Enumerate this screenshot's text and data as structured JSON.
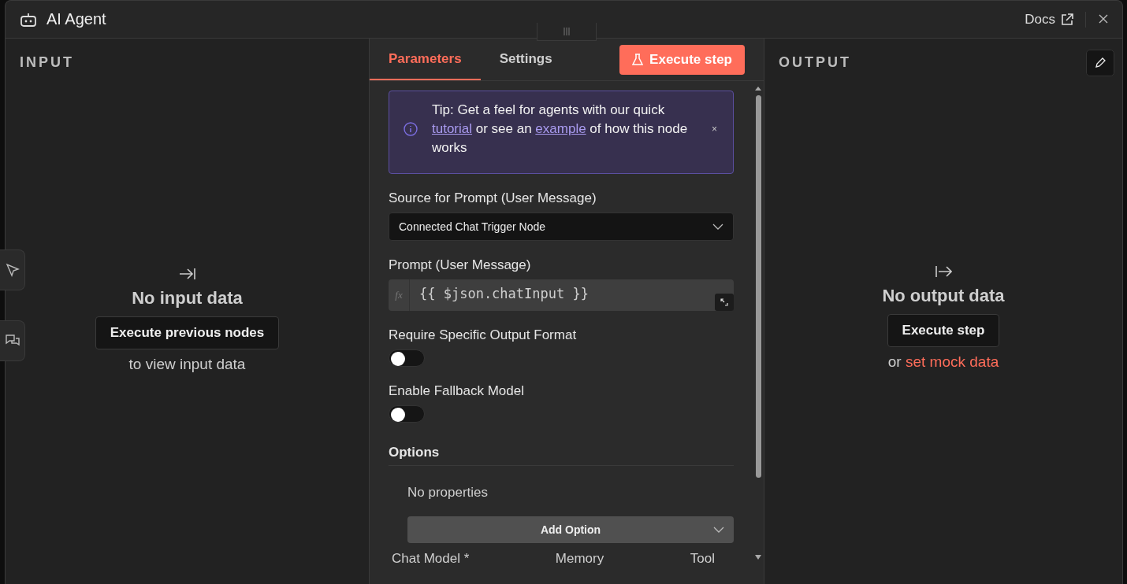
{
  "window": {
    "title": "AI Agent",
    "docs_link": "Docs"
  },
  "input_panel": {
    "heading": "INPUT",
    "empty_title": "No input data",
    "button": "Execute previous nodes",
    "hint": "to view input data"
  },
  "parameters_panel": {
    "tabs": [
      {
        "label": "Parameters",
        "selected": true
      },
      {
        "label": "Settings",
        "selected": false
      }
    ],
    "execute_button": "Execute step",
    "tip": [
      {
        "kind": "text",
        "text": "Tip: Get a feel for agents with our quick "
      },
      {
        "kind": "link",
        "text": "tutorial"
      },
      {
        "kind": "text",
        "text": " or see an "
      },
      {
        "kind": "link",
        "text": "example"
      },
      {
        "kind": "text",
        "text": " of how this node works"
      }
    ],
    "tip_close": "×",
    "fields": [
      {
        "kind": "select",
        "label": "Source for Prompt (User Message)",
        "value": "Connected Chat Trigger Node"
      },
      {
        "kind": "expression",
        "label": "Prompt (User Message)",
        "prefix": "fx",
        "value": "{{ $json.chatInput }}"
      },
      {
        "kind": "toggle",
        "label": "Require Specific Output Format",
        "on": false
      },
      {
        "kind": "toggle",
        "label": "Enable Fallback Model",
        "on": false
      }
    ],
    "options": {
      "heading": "Options",
      "empty": "No properties",
      "add_button": "Add Option"
    },
    "connections": [
      "Chat Model *",
      "Memory",
      "Tool"
    ]
  },
  "output_panel": {
    "heading": "OUTPUT",
    "empty_title": "No output data",
    "button": "Execute step",
    "hint_prefix": "or ",
    "hint_link": "set mock data"
  }
}
